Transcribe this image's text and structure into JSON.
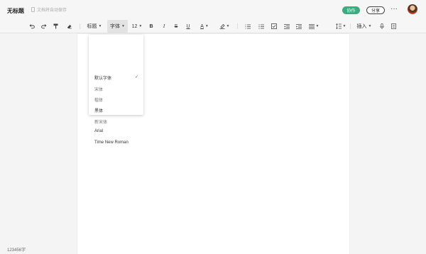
{
  "header": {
    "title": "无标题",
    "save_status": "文档将自动保存",
    "collab_label": "协作",
    "share_label": "分享",
    "more_label": "···"
  },
  "toolbar": {
    "heading_label": "标题",
    "font_label": "字体",
    "font_size": "12",
    "bold": "B",
    "italic": "I",
    "strike": "S",
    "underline": "U",
    "font_color": "A",
    "insert_label": "插入"
  },
  "font_menu": {
    "items": [
      "默认字体",
      "宋体",
      "楷体",
      "黑体",
      "新宋体",
      "Arial",
      "Time New Roman"
    ],
    "selected_index": 0
  },
  "status": {
    "word_count": "123456字"
  },
  "colors": {
    "accent": "#3dab7f",
    "background": "#f4f4f4",
    "page": "#ffffff"
  }
}
